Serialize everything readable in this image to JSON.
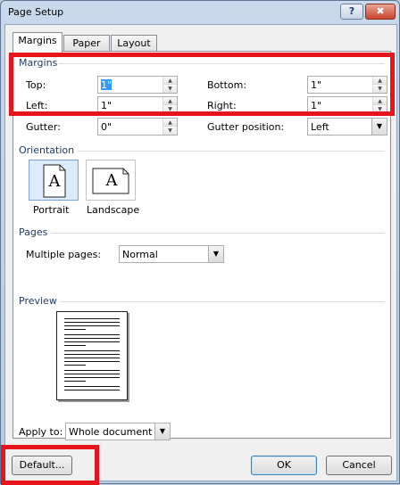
{
  "window": {
    "title": "Page Setup",
    "help_label": "?",
    "close_label": "✖"
  },
  "tabs": [
    {
      "label": "Margins",
      "active": true
    },
    {
      "label": "Paper",
      "active": false
    },
    {
      "label": "Layout",
      "active": false
    }
  ],
  "margins": {
    "section_label": "Margins",
    "top": {
      "label": "Top:",
      "value": "1\""
    },
    "bottom": {
      "label": "Bottom:",
      "value": "1\""
    },
    "left": {
      "label": "Left:",
      "value": "1\""
    },
    "right": {
      "label": "Right:",
      "value": "1\""
    },
    "gutter": {
      "label": "Gutter:",
      "value": "0\""
    },
    "gutter_position": {
      "label": "Gutter position:",
      "value": "Left"
    }
  },
  "orientation": {
    "section_label": "Orientation",
    "portrait_label": "Portrait",
    "landscape_label": "Landscape",
    "glyph": "A",
    "selected": "portrait"
  },
  "pages": {
    "section_label": "Pages",
    "multiple_pages_label": "Multiple pages:",
    "multiple_pages_value": "Normal"
  },
  "preview": {
    "section_label": "Preview"
  },
  "apply_to": {
    "label": "Apply to:",
    "value": "Whole document"
  },
  "buttons": {
    "default_label": "Default...",
    "ok_label": "OK",
    "cancel_label": "Cancel"
  },
  "colors": {
    "highlight": "#e8141b",
    "section_text": "#1e395b",
    "selection": "#3399ff"
  }
}
